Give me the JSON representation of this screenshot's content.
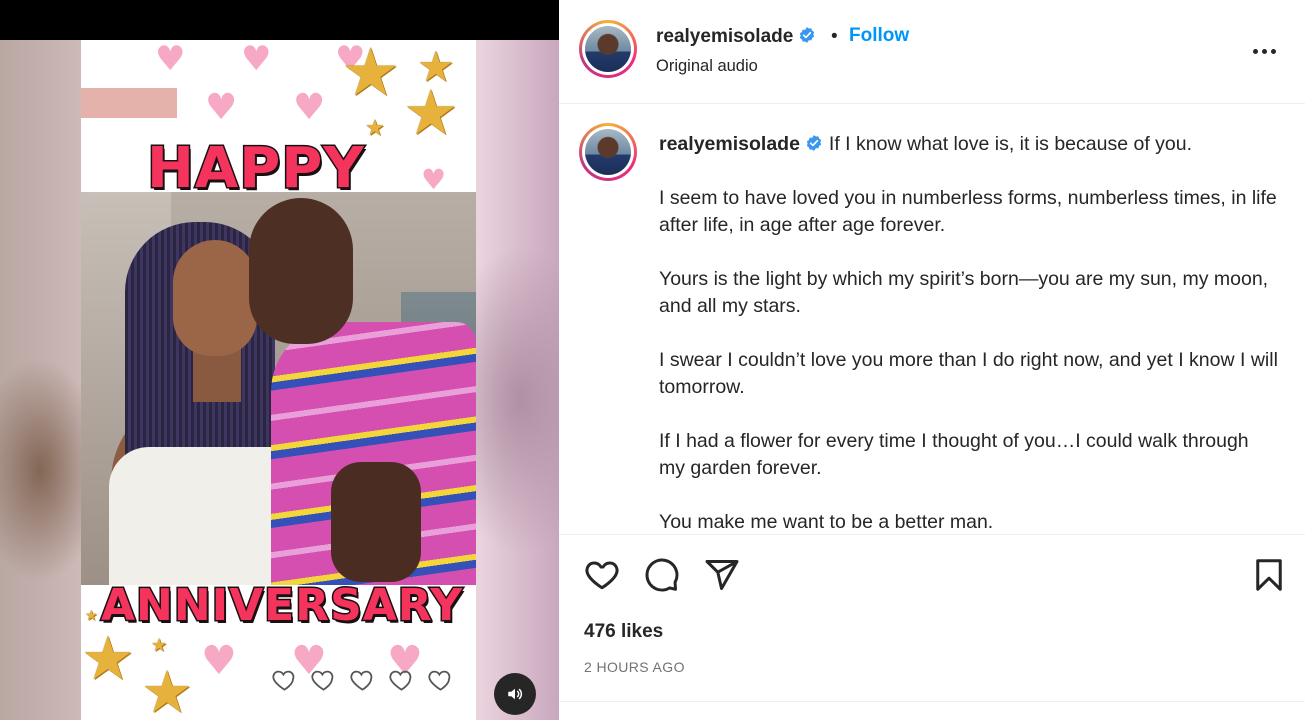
{
  "media": {
    "poster_top_text": "HAPPY",
    "poster_bottom_text": "ANNIVERSARY",
    "volume_icon": "speaker-icon"
  },
  "header": {
    "username": "realyemisolade",
    "verified_icon": "verified-badge-icon",
    "separator": "•",
    "follow_label": "Follow",
    "audio_label": "Original audio",
    "more_icon": "more-options-icon"
  },
  "caption": {
    "username": "realyemisolade",
    "paragraphs": [
      "If I know what love is, it is because of you.",
      "I seem to have loved you in numberless forms, numberless times, in life after life, in age after age forever.",
      "Yours is the light by which my spirit’s born—you are my sun, my moon, and all my stars.",
      "I swear I couldn’t love you more than I do right now, and yet I know I will tomorrow.",
      "If I had a flower for every time I thought of you…I could walk through my garden forever.",
      "You make me want to be a better man."
    ]
  },
  "actions": {
    "like_icon": "heart-icon",
    "comment_icon": "comment-icon",
    "share_icon": "send-icon",
    "save_icon": "bookmark-icon",
    "likes_text": "476 likes",
    "timestamp": "2 HOURS AGO"
  },
  "colors": {
    "follow_blue": "#0095f6",
    "verified_blue": "#3897f0",
    "text": "#262626",
    "muted": "#737373"
  }
}
